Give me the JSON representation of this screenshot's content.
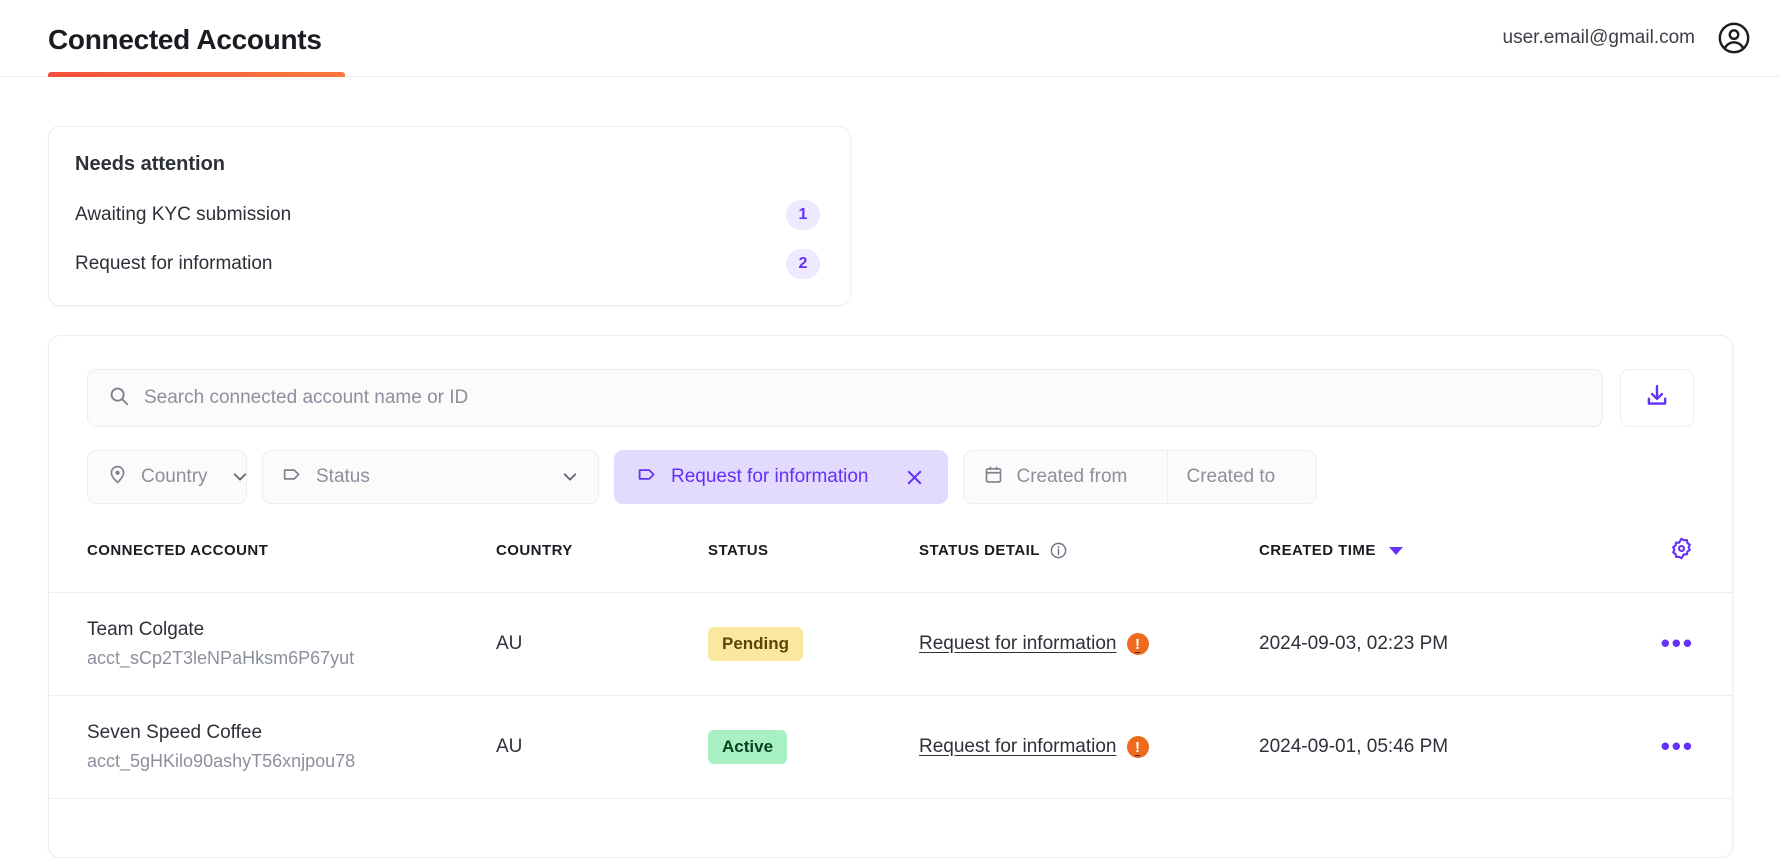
{
  "header": {
    "title": "Connected Accounts",
    "user_email": "user.email@gmail.com",
    "avatar_icon": "account-circle-icon",
    "underline_color_start": "#f4503a",
    "underline_color_end": "#fb7a3c"
  },
  "attention": {
    "title": "Needs attention",
    "items": [
      {
        "label": "Awaiting KYC submission",
        "count": "1"
      },
      {
        "label": "Request for information",
        "count": "2"
      }
    ],
    "badge_bg": "#ede9fe",
    "badge_color": "#6430fa"
  },
  "toolbar": {
    "search": {
      "icon": "search-icon",
      "placeholder": "Search connected account name or ID",
      "value": ""
    },
    "download": {
      "icon": "download-icon",
      "label": ""
    },
    "filters": [
      {
        "name": "country",
        "icon": "location-pin-icon",
        "label": "Country",
        "active": false
      },
      {
        "name": "status",
        "icon": "tag-icon",
        "label": "Status",
        "active": false
      },
      {
        "name": "request-for-information",
        "icon": "tag-icon",
        "label": "Request for information",
        "active": true,
        "close_icon": "close-icon"
      }
    ],
    "date_range": {
      "icon": "calendar-icon",
      "from_placeholder": "Created from",
      "to_placeholder": "Created to"
    },
    "accent_color": "#6430fa",
    "active_chip_bg": "#e3dbfe"
  },
  "table": {
    "columns": [
      {
        "key": "account",
        "label": "CONNECTED ACCOUNT"
      },
      {
        "key": "country",
        "label": "COUNTRY"
      },
      {
        "key": "status",
        "label": "STATUS"
      },
      {
        "key": "detail",
        "label": "STATUS DETAIL",
        "info_icon": "info-icon"
      },
      {
        "key": "created",
        "label": "CREATED TIME",
        "sort": "desc"
      },
      {
        "key": "settings",
        "label": "",
        "icon": "gear-icon"
      }
    ],
    "rows": [
      {
        "name": "Team Colgate",
        "id": "acct_sCp2T3leNPaHksm6P67yut",
        "country": "AU",
        "status": "Pending",
        "status_type": "pending",
        "status_detail": "Request for information",
        "detail_alert_icon": "alert-icon",
        "created": "2024-09-03, 02:23 PM",
        "menu_icon": "more-horizontal-icon"
      },
      {
        "name": "Seven Speed Coffee",
        "id": "acct_5gHKilo90ashyT56xnjpou78",
        "country": "AU",
        "status": "Active",
        "status_type": "active",
        "status_detail": "Request for information",
        "detail_alert_icon": "alert-icon",
        "created": "2024-09-01, 05:46 PM",
        "menu_icon": "more-horizontal-icon"
      }
    ],
    "badge_colors": {
      "pending_bg": "#fbe8a0",
      "pending_text": "#5b4708",
      "active_bg": "#a7f0c3",
      "active_text": "#08431f",
      "alert": "#ed6a1f"
    }
  }
}
